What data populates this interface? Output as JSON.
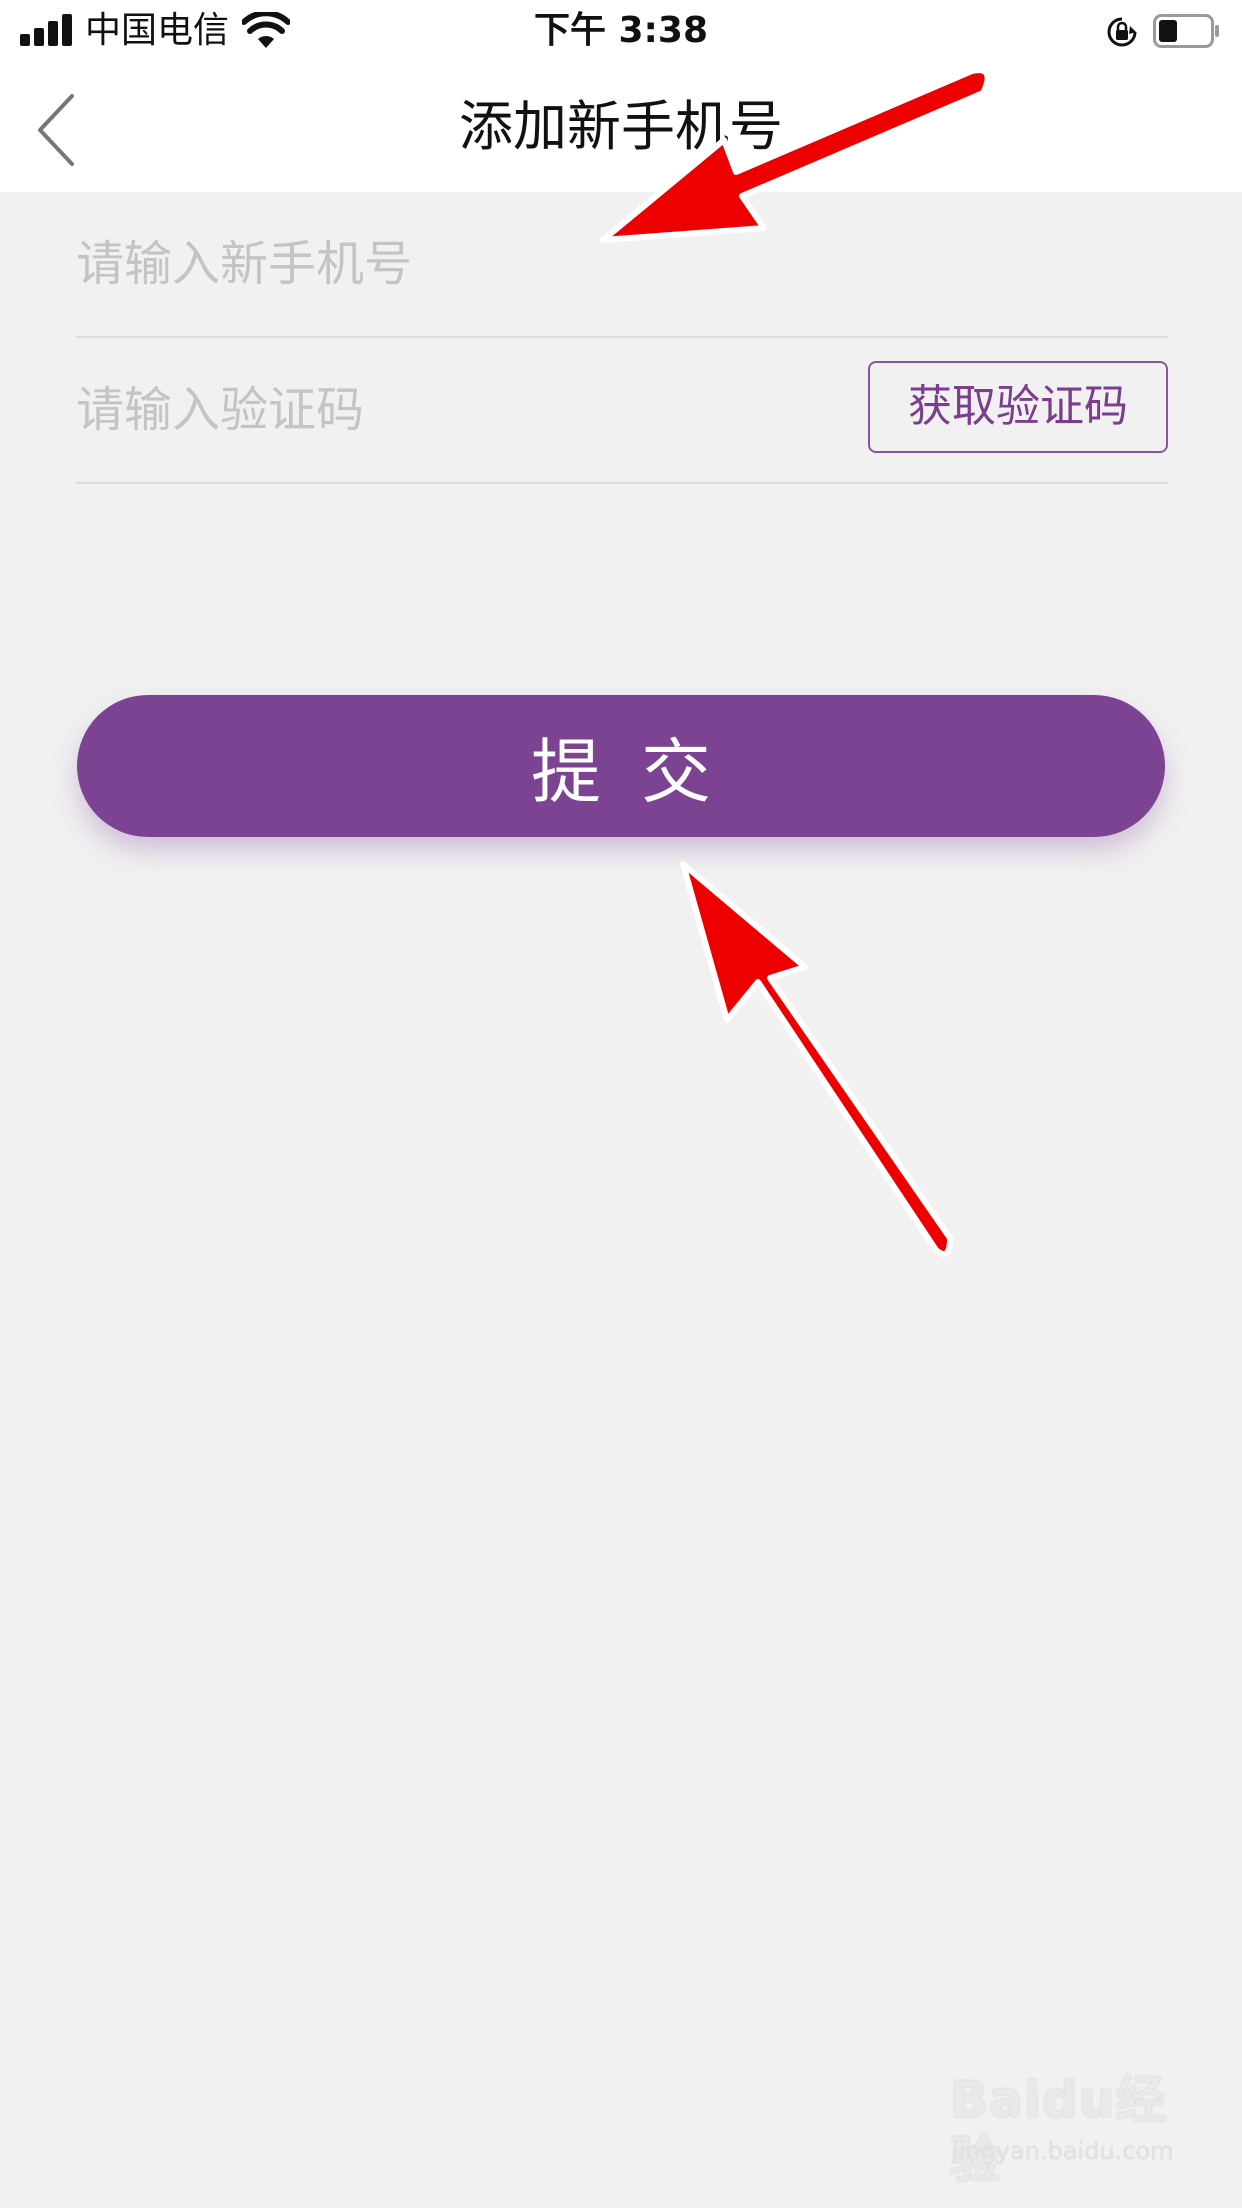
{
  "status_bar": {
    "carrier": "中国电信",
    "time": "下午 3:38",
    "icons": [
      "signal-icon",
      "wifi-icon",
      "orientation-lock-icon",
      "battery-icon"
    ]
  },
  "nav": {
    "title": "添加新手机号",
    "back_icon": "chevron-left-icon"
  },
  "form": {
    "phone_input": {
      "value": "",
      "placeholder": "请输入新手机号"
    },
    "code_input": {
      "value": "",
      "placeholder": "请输入验证码"
    },
    "get_code_label": "获取验证码"
  },
  "submit_label": "提交",
  "watermark": {
    "brand": "Baidu经验",
    "url": "jingyan.baidu.com"
  },
  "colors": {
    "accent": "#7d4393",
    "background": "#f1f1f1",
    "annotation_arrow": "#ff0000"
  }
}
